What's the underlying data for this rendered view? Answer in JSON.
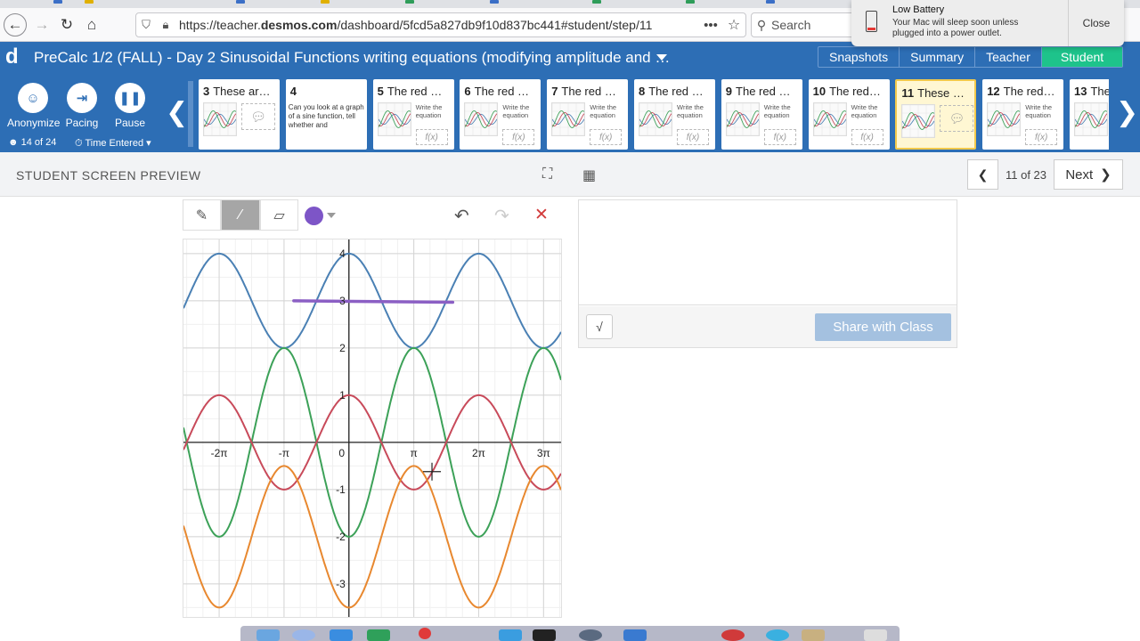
{
  "browser": {
    "url_prefix": "https://teacher.",
    "url_domain": "desmos.com",
    "url_rest": "/dashboard/5fcd5a827db9f10d837bc441#student/step/11",
    "search_placeholder": "Search"
  },
  "notification": {
    "title": "Low Battery",
    "message": "Your Mac will sleep soon unless plugged into a power outlet.",
    "close_label": "Close"
  },
  "header": {
    "logo": "d",
    "title": "PreCalc 1/2 (FALL) - Day 2 Sinusoidal Functions writing equations (modifying amplitude and …",
    "modes": [
      "Snapshots",
      "Summary",
      "Teacher",
      "Student"
    ],
    "active_mode": "Student"
  },
  "controls": {
    "anonymize": "Anonymize",
    "pacing": "Pacing",
    "pause": "Pause",
    "count": "14 of 24",
    "sort": "Time Entered"
  },
  "cards": [
    {
      "num": "3",
      "title": "These ar…",
      "kind": "graph-chat"
    },
    {
      "num": "4",
      "title": "",
      "desc": "Can you look at a graph of a sine function, tell whether and",
      "kind": "text"
    },
    {
      "num": "5",
      "title": "The red …",
      "desc": "Write the equation",
      "fx": "f(x)",
      "kind": "graph-fx"
    },
    {
      "num": "6",
      "title": "The red …",
      "desc": "Write the equation",
      "fx": "f(x)",
      "kind": "graph-fx"
    },
    {
      "num": "7",
      "title": "The red …",
      "desc": "Write the equation",
      "fx": "f(x)",
      "kind": "graph-fx"
    },
    {
      "num": "8",
      "title": "The red …",
      "desc": "Write the equation",
      "fx": "f(x)",
      "kind": "graph-fx"
    },
    {
      "num": "9",
      "title": "The red …",
      "desc": "Write the equation",
      "fx": "f(x)",
      "kind": "graph-fx"
    },
    {
      "num": "10",
      "title": "The red…",
      "desc": "Write the equation",
      "fx": "f(x)",
      "kind": "graph-fx"
    },
    {
      "num": "11",
      "title": "These …",
      "kind": "graph-chat",
      "selected": true
    },
    {
      "num": "12",
      "title": "The red…",
      "desc": "Write the equation",
      "fx": "f(x)",
      "kind": "graph-fx"
    },
    {
      "num": "13",
      "title": "The…",
      "kind": "graph"
    }
  ],
  "preview": {
    "label": "STUDENT SCREEN PREVIEW",
    "page_count": "11 of 23",
    "next_label": "Next"
  },
  "graph": {
    "x_tick_labels": [
      "-2π",
      "-π",
      "0",
      "π",
      "2π",
      "3π"
    ],
    "y_tick_labels": [
      "4",
      "3",
      "2",
      "1",
      "-1",
      "-2",
      "-3"
    ]
  },
  "response": {
    "sqrt_label": "√",
    "share_label": "Share with Class"
  },
  "colors": {
    "header_blue": "#2d6eb5",
    "student_green": "#1ec38b",
    "blue_curve": "#4a80b4",
    "green_curve": "#3ca158",
    "red_curve": "#c84a5a",
    "orange_curve": "#e8882f",
    "purple_stroke": "#8b5fc4"
  }
}
